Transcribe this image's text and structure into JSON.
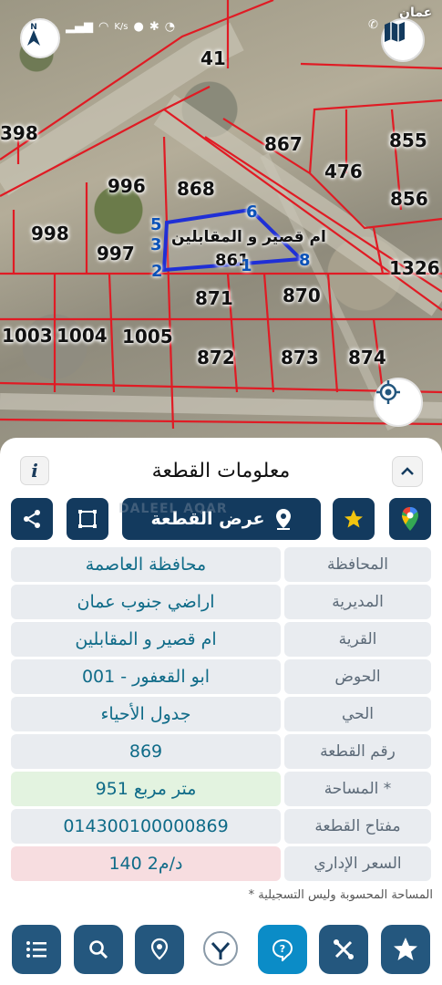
{
  "status_bar": {
    "speed": "K/s",
    "right_text": "عمان"
  },
  "map": {
    "parcel_labels": [
      "41",
      "398",
      "867",
      "855",
      "476",
      "856",
      "996",
      "868",
      "998",
      "997",
      "1326",
      "871",
      "870",
      "1003",
      "1004",
      "1005",
      "872",
      "873",
      "874",
      "861"
    ],
    "vertex_labels": [
      "5",
      "3",
      "2",
      "6",
      "1",
      "8"
    ],
    "village_overlay": "ام قصير و المقابلين"
  },
  "panel": {
    "title": "معلومات القطعة",
    "info_icon": "i",
    "view_parcel_label": "عرض القطعة",
    "watermark": "DALEEL AQAR",
    "rows": [
      {
        "label": "المحافظة",
        "value": "محافظة العاصمة",
        "color": "#e9ecf0"
      },
      {
        "label": "المديرية",
        "value": "اراضي جنوب عمان",
        "color": "#e9ecf0"
      },
      {
        "label": "القرية",
        "value": "ام قصير و المقابلين",
        "color": "#e9ecf0"
      },
      {
        "label": "الحوض",
        "value": "ابو القعفور - 001",
        "color": "#e9ecf0"
      },
      {
        "label": "الحي",
        "value": "جدول الأحياء",
        "color": "#e9ecf0"
      },
      {
        "label": "رقم القطعة",
        "value": "869",
        "color": "#e9ecf0"
      },
      {
        "label": "المساحة *",
        "value": "951  متر مربع",
        "color": "#e3f3e0"
      },
      {
        "label": "مفتاح القطعة",
        "value": "014300100000869",
        "color": "#e9ecf0"
      },
      {
        "label": "السعر الإداري",
        "value": "140 د/م2",
        "color": "#f7dde0"
      }
    ],
    "footnote": "* المساحة المحسوبة وليس التسجيلية"
  },
  "colors": {
    "primary": "#133a5e",
    "accent": "#0b8cc7",
    "boundary": "#e01b24",
    "parcel_highlight": "#1f2fd6",
    "value_text": "#0f6b88"
  },
  "icons": {
    "compass": "north-arrow-icon",
    "map_type": "book-map-icon",
    "locate": "crosshair-icon",
    "share": "share-icon",
    "measure": "polygon-icon",
    "pin": "map-pin-icon",
    "star": "star-icon",
    "gmaps": "google-maps-icon",
    "list": "list-icon",
    "search": "search-icon",
    "pin_nav": "location-icon",
    "help": "help-icon",
    "tools": "tools-icon",
    "favorite": "favorite-star-icon"
  }
}
